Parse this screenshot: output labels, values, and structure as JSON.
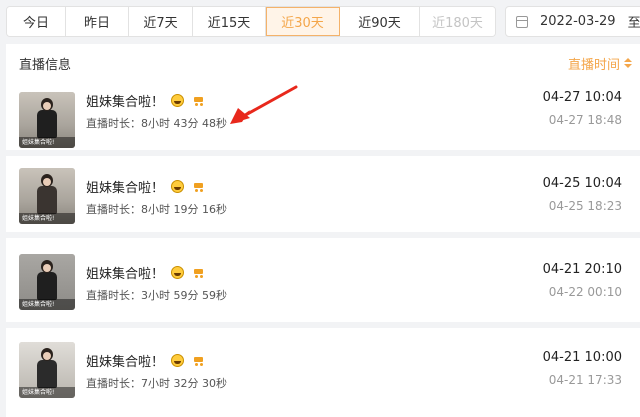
{
  "tabs": [
    {
      "label": "今日",
      "state": "normal"
    },
    {
      "label": "昨日",
      "state": "normal"
    },
    {
      "label": "近7天",
      "state": "normal"
    },
    {
      "label": "近15天",
      "state": "normal"
    },
    {
      "label": "近30天",
      "state": "active"
    },
    {
      "label": "近90天",
      "state": "normal"
    },
    {
      "label": "近180天",
      "state": "disabled"
    }
  ],
  "date_picker": {
    "value": "2022-03-29",
    "separator": "至"
  },
  "panel": {
    "title": "直播信息",
    "sort_label": "直播时间"
  },
  "rows": [
    {
      "title": "姐妹集合啦！",
      "thumb_caption": "姐妹集合啦!",
      "duration": "直播时长：8小时 43分 48秒",
      "start": "04-27 10:04",
      "end": "04-27 18:48"
    },
    {
      "title": "姐妹集合啦！",
      "thumb_caption": "姐妹集合啦!",
      "duration": "直播时长：8小时 19分 16秒",
      "start": "04-25 10:04",
      "end": "04-25 18:23"
    },
    {
      "title": "姐妹集合啦！",
      "thumb_caption": "姐妹集合啦!",
      "duration": "直播时长：3小时 59分 59秒",
      "start": "04-21 20:10",
      "end": "04-22 00:10"
    },
    {
      "title": "姐妹集合啦！",
      "thumb_caption": "姐妹集合啦!",
      "duration": "直播时长：7小时 32分 30秒",
      "start": "04-21 10:00",
      "end": "04-21 17:33"
    }
  ],
  "colors": {
    "accent": "#f4a64a",
    "arrow": "#e8281c"
  }
}
